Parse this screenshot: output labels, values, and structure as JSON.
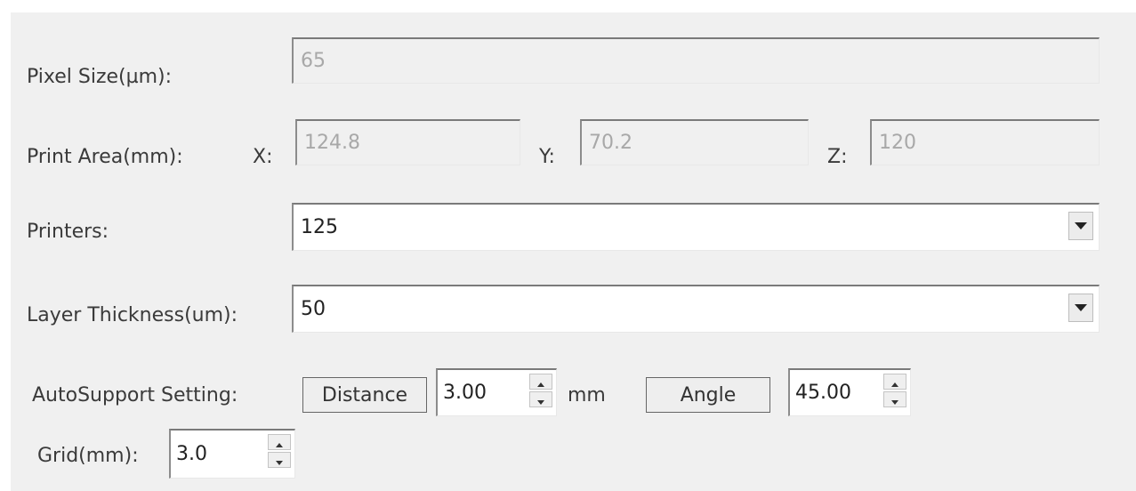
{
  "pixel_size": {
    "label": "Pixel Size(µm):",
    "value": "65"
  },
  "print_area": {
    "label": "Print Area(mm):",
    "x_label": "X:",
    "x_value": "124.8",
    "y_label": "Y:",
    "y_value": "70.2",
    "z_label": "Z:",
    "z_value": "120"
  },
  "printers": {
    "label": "Printers:",
    "selected": "125"
  },
  "layer_thickness": {
    "label": "Layer Thickness(um):",
    "selected": "50"
  },
  "autosupport": {
    "label": "AutoSupport Setting:",
    "distance_button": "Distance",
    "distance_value": "3.00",
    "distance_unit": "mm",
    "angle_button": "Angle",
    "angle_value": "45.00"
  },
  "grid": {
    "label": "Grid(mm):",
    "value": "3.0"
  },
  "icons": {
    "dropdown": "chevron-down-icon",
    "spin_up": "arrow-up-icon",
    "spin_down": "arrow-down-icon"
  },
  "colors": {
    "panel": "#f0f0f0",
    "disabled_text": "#a8a8a8",
    "border": "#7a7a7a"
  }
}
